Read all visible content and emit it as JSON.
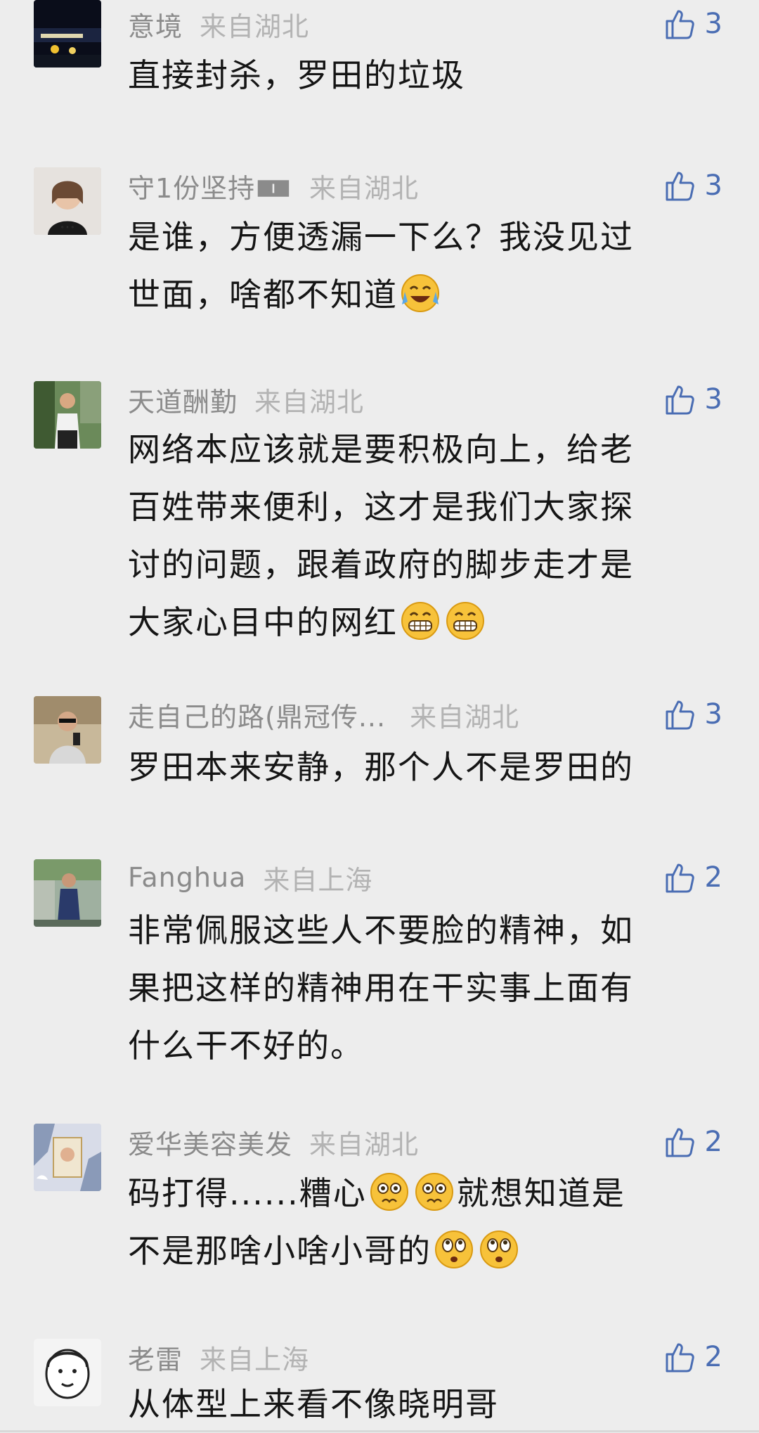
{
  "comments": [
    {
      "name": "意境",
      "location": "来自湖北",
      "likes": "3",
      "lines": [
        "直接封杀，罗田的垃圾"
      ],
      "emoji": ""
    },
    {
      "name": "守1份坚持🀰",
      "location": "来自湖北",
      "likes": "3",
      "lines": [
        "是谁，方便透漏一下么？我没见过",
        "世面，啥都不知道"
      ],
      "emoji": "laugh-cry"
    },
    {
      "name": "天道酬勤",
      "location": "来自湖北",
      "likes": "3",
      "lines": [
        "网络本应该就是要积极向上，给老",
        "百姓带来便利，这才是我们大家探",
        "讨的问题，跟着政府的脚步走才是",
        "大家心目中的网红"
      ],
      "emoji": "grin"
    },
    {
      "name": "走自己的路(鼎冠传...",
      "location": "来自湖北",
      "likes": "3",
      "lines": [
        "罗田本来安静，那个人不是罗田的"
      ],
      "emoji": ""
    },
    {
      "name": "Fanghua",
      "location": "来自上海",
      "likes": "2",
      "lines": [
        "非常佩服这些人不要脸的精神，如",
        "果把这样的精神用在干实事上面有",
        "什么干不好的。"
      ],
      "emoji": ""
    },
    {
      "name": "爱华美容美发",
      "location": "来自湖北",
      "likes": "2",
      "lines": [
        "码打得......糟心",
        "不是那啥小啥小哥的"
      ],
      "line_suffix": [
        "就想知道是",
        ""
      ],
      "emoji": "worried"
    },
    {
      "name": "老雷",
      "location": "来自上海",
      "likes": "2",
      "lines": [
        "从体型上来看不像晓明哥"
      ],
      "emoji": ""
    }
  ],
  "colors": {
    "background": "#ededed",
    "username": "#8b8b8b",
    "location": "#b3b3b3",
    "like": "#4a6db3",
    "text": "#151515"
  }
}
